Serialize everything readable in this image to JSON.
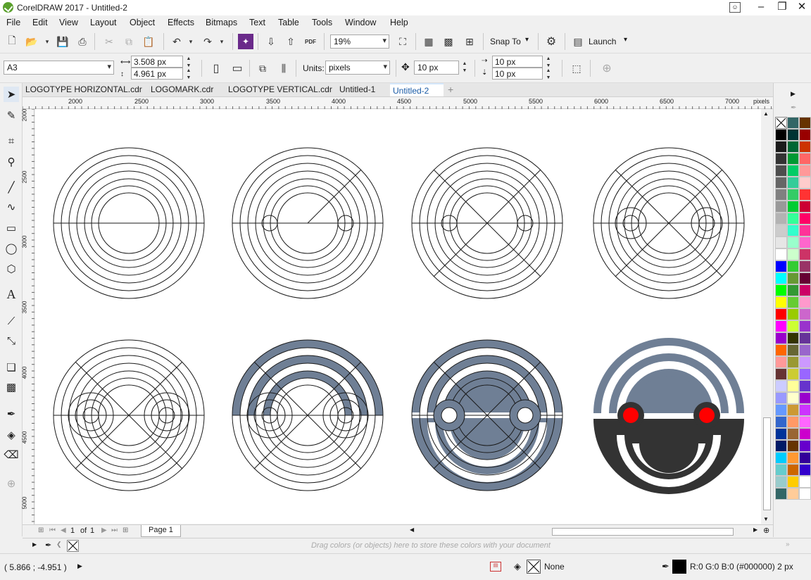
{
  "app": {
    "title": "CorelDRAW 2017 - Untitled-2"
  },
  "window_controls": {
    "minimize": "–",
    "maximize": "❐",
    "close": "✕"
  },
  "menu": [
    "File",
    "Edit",
    "View",
    "Layout",
    "Object",
    "Effects",
    "Bitmaps",
    "Text",
    "Table",
    "Tools",
    "Window",
    "Help"
  ],
  "toolbar": {
    "zoom": "19%",
    "snap_to": "Snap To",
    "launch": "Launch",
    "pdf": "PDF"
  },
  "property_bar": {
    "page_size": "A3",
    "width": "3.508 px",
    "height": "4.961 px",
    "units_label": "Units:",
    "units": "pixels",
    "nudge": "10 px",
    "dup_x": "10 px",
    "dup_y": "10 px"
  },
  "tabs": [
    "LOGOTYPE HORIZONTAL.cdr",
    "LOGOMARK.cdr",
    "LOGOTYPE VERTICAL.cdr",
    "Untitled-1",
    "Untitled-2"
  ],
  "active_tab": "Untitled-2",
  "ruler": {
    "h_ticks": [
      "2000",
      "2500",
      "3000",
      "3500",
      "4000",
      "4500",
      "5000",
      "5500",
      "6000",
      "6500",
      "7000"
    ],
    "unit": "pixels",
    "v_ticks": [
      "2000",
      "2500",
      "3000",
      "3500",
      "4000",
      "4500",
      "5000"
    ]
  },
  "page_nav": {
    "current": "1",
    "of": "of",
    "total": "1",
    "page_tab": "Page 1"
  },
  "doc_palette_hint": "Drag colors (or objects) here to store these colors with your document",
  "status": {
    "coords": "( 5.866 ; -4.951 )",
    "fill": "None",
    "outline": "R:0 G:0 B:0 (#000000)  2 px"
  },
  "colors": {
    "logo_blue": "#6f7f95",
    "logo_dark": "#333333",
    "logo_eye": "#ff0000",
    "tab_active": "#1a5ba6",
    "palette_col1": [
      "#ffffff",
      "#000000",
      "#1a1a1a",
      "#333333",
      "#4d4d4d",
      "#666666",
      "#808080",
      "#999999",
      "#b3b3b3",
      "#cccccc",
      "#e6e6e6",
      "#ffffff",
      "#0000ff",
      "#00ffff",
      "#00ff00",
      "#ffff00",
      "#ff0000",
      "#ff00ff",
      "#9900cc",
      "#ff6600",
      "#ff9999",
      "#663333",
      "#ccccff",
      "#9999ff",
      "#6699ff",
      "#3366cc",
      "#003399",
      "#001a66",
      "#00ccff",
      "#66cccc",
      "#99cccc",
      "#336666"
    ],
    "palette_col2": [
      "#336666",
      "#003333",
      "#006633",
      "#009933",
      "#00cc66",
      "#33cc99",
      "#33cc66",
      "#00cc33",
      "#33ff99",
      "#33ffcc",
      "#99ffcc",
      "#ccffcc",
      "#33cc33",
      "#669933",
      "#339933",
      "#66cc33",
      "#99cc00",
      "#ccff33",
      "#333300",
      "#666633",
      "#999933",
      "#cccc33",
      "#ffff99",
      "#ffffcc",
      "#cc9933",
      "#ff9966",
      "#996633",
      "#663300",
      "#ff9933",
      "#cc6600",
      "#ffcc00",
      "#ffcc99"
    ],
    "palette_col3": [
      "#663300",
      "#990000",
      "#cc3300",
      "#ff6666",
      "#ff9999",
      "#ffcccc",
      "#ff3333",
      "#cc0033",
      "#ff0066",
      "#ff3399",
      "#ff66cc",
      "#cc3366",
      "#993366",
      "#660033",
      "#cc0066",
      "#ff99cc",
      "#cc66cc",
      "#9933cc",
      "#663399",
      "#9966cc",
      "#cc99ff",
      "#9966ff",
      "#6633cc",
      "#9900cc",
      "#cc33ff",
      "#ff66ff",
      "#cc00cc",
      "#6600cc",
      "#330099",
      "#3300cc",
      "#ffffff",
      "#ffffff"
    ]
  }
}
